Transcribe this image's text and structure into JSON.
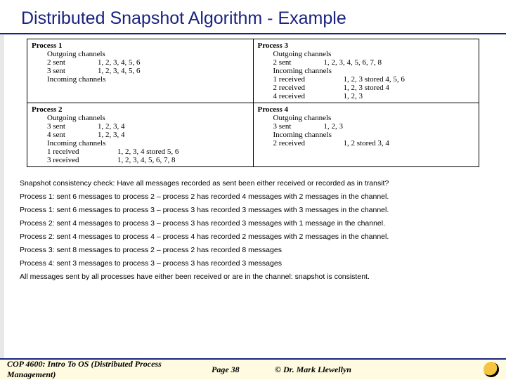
{
  "title": "Distributed Snapshot Algorithm - Example",
  "p1": {
    "name": "Process 1",
    "out_h": "Outgoing channels",
    "out": [
      {
        "lab": "2 sent",
        "vals": "1, 2, 3, 4, 5, 6"
      },
      {
        "lab": "3 sent",
        "vals": "1, 2, 3, 4, 5, 6"
      }
    ],
    "in_h": "Incoming channels",
    "in": []
  },
  "p2": {
    "name": "Process 2",
    "out_h": "Outgoing channels",
    "out": [
      {
        "lab": "3 sent",
        "vals": "1, 2, 3, 4"
      },
      {
        "lab": "4 sent",
        "vals": "1, 2, 3, 4"
      }
    ],
    "in_h": "Incoming channels",
    "in": [
      {
        "lab": "1 received",
        "vals": "1, 2, 3, 4 stored 5, 6"
      },
      {
        "lab": "3 received",
        "vals": "1, 2, 3, 4, 5, 6, 7, 8"
      }
    ]
  },
  "p3": {
    "name": "Process 3",
    "out_h": "Outgoing channels",
    "out": [
      {
        "lab": "2 sent",
        "vals": "1, 2, 3, 4, 5, 6, 7, 8"
      }
    ],
    "in_h": "Incoming channels",
    "in": [
      {
        "lab": "1 received",
        "vals": "1, 2, 3 stored 4, 5, 6"
      },
      {
        "lab": "2 received",
        "vals": "1, 2, 3 stored 4"
      },
      {
        "lab": "4 received",
        "vals": "1, 2, 3"
      }
    ]
  },
  "p4": {
    "name": "Process 4",
    "out_h": "Outgoing channels",
    "out": [
      {
        "lab": "3 sent",
        "vals": "1, 2, 3"
      }
    ],
    "in_h": "Incoming channels",
    "in": [
      {
        "lab": "2 received",
        "vals": "1, 2 stored 3, 4"
      }
    ]
  },
  "notes": [
    "Snapshot consistency check:  Have all messages recorded as sent been either received or recorded as in transit?",
    "Process 1: sent 6 messages to process 2 – process 2 has recorded 4 messages with 2 messages in the channel.",
    "Process 1: sent 6 messages to process 3 – process 3 has recorded 3 messages with 3 messages in the channel.",
    "Process 2: sent 4 messages to process 3 – process 3 has recorded 3 messages with 1 message in the channel.",
    "Process 2: sent 4 messages to process 4 – process 4 has recorded 2 messages with 2 messages in the channel.",
    "Process 3: sent 8 messages to process 2 – process 2 has recorded 8 messages",
    "Process 4: sent 3 messages to process 3 – process 3 has recorded 3 messages",
    "All messages sent by all processes have either been received or are in the channel: snapshot is consistent."
  ],
  "footer": {
    "course": "COP 4600: Intro To OS  (Distributed Process Management)",
    "page": "Page 38",
    "copy": "© Dr. Mark Llewellyn"
  }
}
